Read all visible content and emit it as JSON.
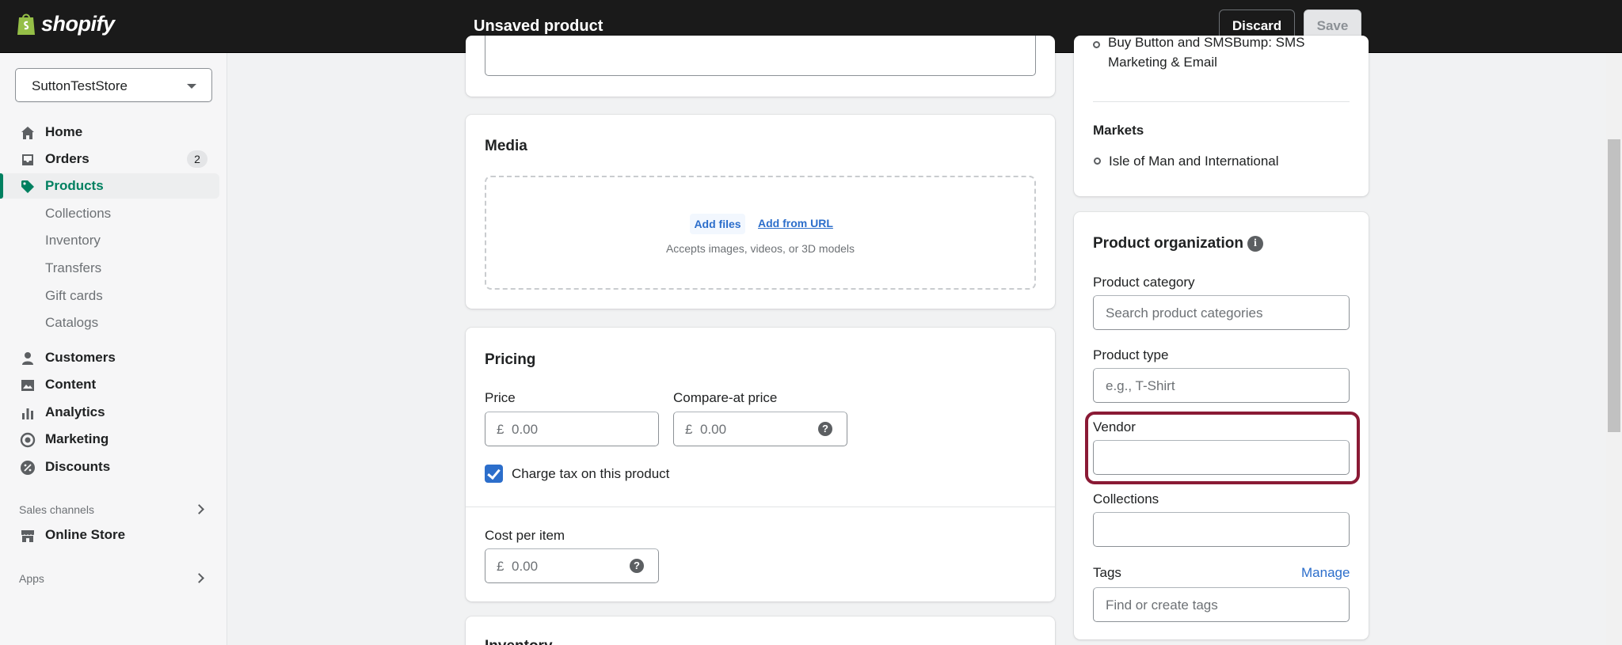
{
  "topbar": {
    "logo_text": "shopify",
    "page_title": "Unsaved product",
    "discard_label": "Discard",
    "save_label": "Save"
  },
  "sidebar": {
    "store_name": "SuttonTestStore",
    "nav": [
      {
        "label": "Home",
        "icon": "home-icon"
      },
      {
        "label": "Orders",
        "icon": "orders-icon",
        "badge": "2"
      },
      {
        "label": "Products",
        "icon": "tag-icon",
        "active": true
      },
      {
        "label": "Customers",
        "icon": "person-icon"
      },
      {
        "label": "Content",
        "icon": "image-icon"
      },
      {
        "label": "Analytics",
        "icon": "bar-chart-icon"
      },
      {
        "label": "Marketing",
        "icon": "target-icon"
      },
      {
        "label": "Discounts",
        "icon": "discount-icon"
      }
    ],
    "product_subitems": [
      "Collections",
      "Inventory",
      "Transfers",
      "Gift cards",
      "Catalogs"
    ],
    "sales_channels_label": "Sales channels",
    "online_store_label": "Online Store",
    "apps_label": "Apps"
  },
  "main": {
    "media": {
      "title": "Media",
      "add_files": "Add files",
      "add_from_url": "Add from URL",
      "hint": "Accepts images, videos, or 3D models"
    },
    "pricing": {
      "title": "Pricing",
      "price_label": "Price",
      "compare_label": "Compare-at price",
      "currency": "£",
      "price_placeholder": "0.00",
      "compare_placeholder": "0.00",
      "charge_tax_label": "Charge tax on this product",
      "charge_tax_checked": true,
      "cost_label": "Cost per item",
      "cost_placeholder": "0.00"
    },
    "next_card_title_partial": "Inventory"
  },
  "right": {
    "channel_text": "Buy Button and SMSBump: SMS Marketing & Email",
    "markets_title": "Markets",
    "markets_item": "Isle of Man and International",
    "org": {
      "title": "Product organization",
      "category_label": "Product category",
      "category_placeholder": "Search product categories",
      "type_label": "Product type",
      "type_placeholder": "e.g., T-Shirt",
      "vendor_label": "Vendor",
      "vendor_value": "",
      "collections_label": "Collections",
      "tags_label": "Tags",
      "tags_manage": "Manage",
      "tags_placeholder": "Find or create tags"
    }
  },
  "colors": {
    "accent_green": "#008060",
    "link_blue": "#2c6ecb",
    "highlight": "#8a1a35"
  }
}
